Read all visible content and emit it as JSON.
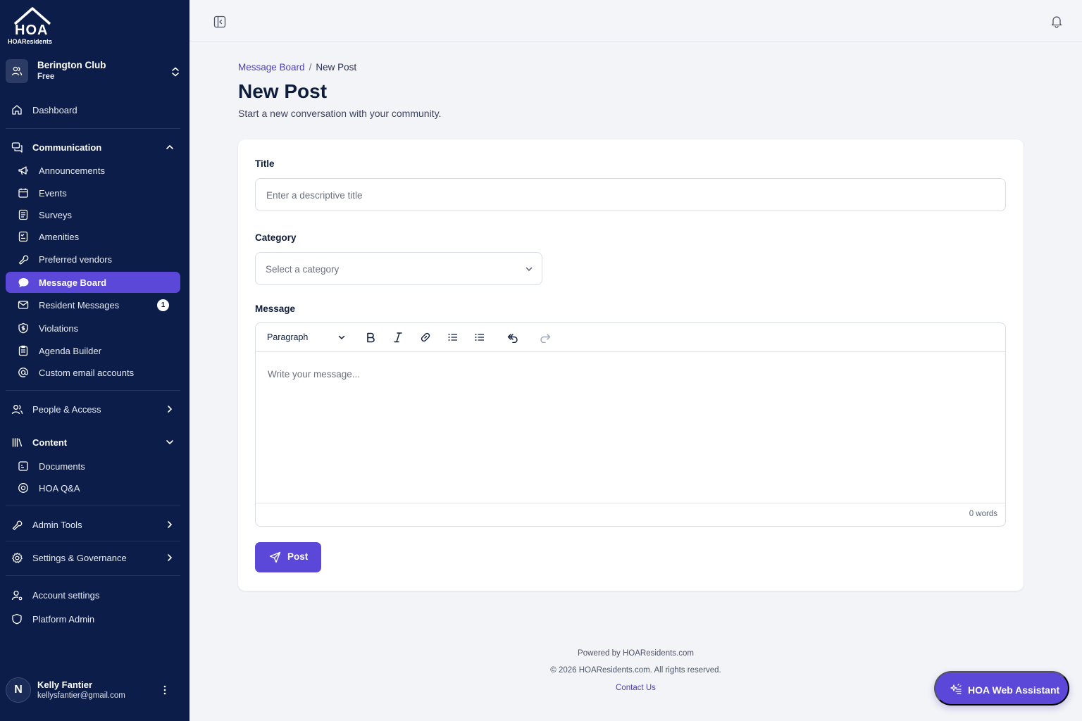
{
  "brand": {
    "logo_mark": "HOA",
    "logo_text": "HOAResidents"
  },
  "org": {
    "name": "Berington Club",
    "plan": "Free"
  },
  "sidebar": {
    "dashboard": "Dashboard",
    "communication": {
      "label": "Communication",
      "items": [
        {
          "label": "Announcements",
          "icon": "megaphone-icon"
        },
        {
          "label": "Events",
          "icon": "calendar-icon"
        },
        {
          "label": "Surveys",
          "icon": "survey-icon"
        },
        {
          "label": "Amenities",
          "icon": "amenities-icon"
        },
        {
          "label": "Preferred vendors",
          "icon": "wrench-icon"
        },
        {
          "label": "Message Board",
          "icon": "chat-bubble-icon",
          "active": true
        },
        {
          "label": "Resident Messages",
          "icon": "mail-icon",
          "badge": "1"
        },
        {
          "label": "Violations",
          "icon": "shield-dollar-icon"
        },
        {
          "label": "Agenda Builder",
          "icon": "agenda-icon"
        },
        {
          "label": "Custom email accounts",
          "icon": "at-sign-icon"
        }
      ]
    },
    "people_access": "People & Access",
    "content": {
      "label": "Content",
      "items": [
        {
          "label": "Documents",
          "icon": "documents-icon"
        },
        {
          "label": "HOA Q&A",
          "icon": "qa-icon"
        }
      ]
    },
    "admin_tools": "Admin Tools",
    "settings_governance": "Settings & Governance",
    "account_settings": "Account settings",
    "platform_admin": "Platform Admin"
  },
  "user": {
    "initial": "N",
    "name": "Kelly Fantier",
    "email": "kellysfantier@gmail.com"
  },
  "breadcrumb": {
    "parent": "Message Board",
    "separator": "/",
    "current": "New Post"
  },
  "page": {
    "title": "New Post",
    "subtitle": "Start a new conversation with your community."
  },
  "form": {
    "title_label": "Title",
    "title_placeholder": "Enter a descriptive title",
    "category_label": "Category",
    "category_placeholder": "Select a category",
    "message_label": "Message",
    "paragraph_style": "Paragraph",
    "message_placeholder": "Write your message...",
    "word_count": "0 words",
    "post_label": "Post"
  },
  "footer": {
    "powered_by": "Powered by HOAResidents.com",
    "copyright": "© 2026 HOAResidents.com. All rights reserved.",
    "contact": "Contact Us"
  },
  "assistant": {
    "label": "HOA Web Assistant"
  },
  "colors": {
    "sidebar_bg": "#0c1d4a",
    "accent": "#5b48d9",
    "page_bg": "#f3f4f8"
  }
}
